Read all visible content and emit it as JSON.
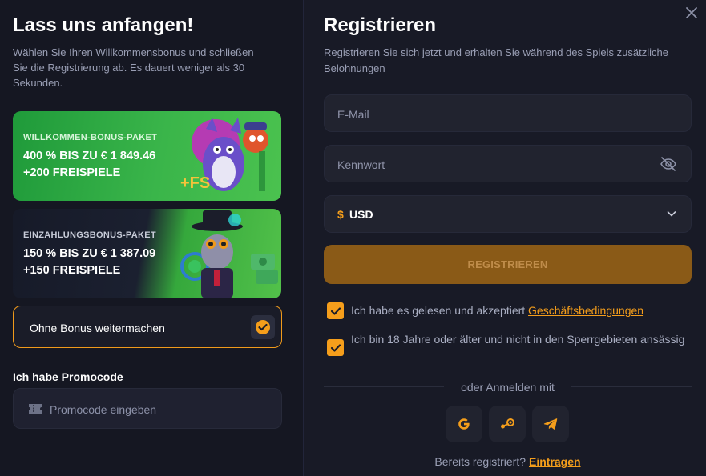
{
  "left": {
    "title": "Lass uns anfangen!",
    "subtitle": "Wählen Sie Ihren Willkommensbonus und schließen Sie die Registrierung ab. Es dauert weniger als 30 Sekunden.",
    "bonuses": [
      {
        "label": "WILLKOMMEN-BONUS-PAKET",
        "line1": "400 % BIS ZU € 1 849.46",
        "line2": "+200 FREISPIELE",
        "badge": "+FS"
      },
      {
        "label": "EINZAHLUNGSBONUS-PAKET",
        "line1": "150 % BIS ZU € 1 387.09",
        "line2": "+150 FREISPIELE"
      }
    ],
    "no_bonus_label": "Ohne Bonus weitermachen",
    "promo_title": "Ich habe Promocode",
    "promo_placeholder": "Promocode eingeben"
  },
  "right": {
    "title": "Registrieren",
    "subtitle": "Registrieren Sie sich jetzt und erhalten Sie während des Spiels zusätzliche Belohnungen",
    "email_placeholder": "E-Mail",
    "password_placeholder": "Kennwort",
    "currency_symbol": "$",
    "currency_value": "USD",
    "register_label": "REGISTRIEREN",
    "terms_text": "Ich habe es gelesen und akzeptiert",
    "terms_link": "Geschäftsbedingungen",
    "age_text": "Ich bin 18 Jahre oder älter und nicht in den Sperrgebieten ansässig",
    "or_text": "oder Anmelden mit",
    "footer_text": "Bereits registriert?",
    "footer_link": "Eintragen"
  },
  "colors": {
    "accent": "#f59e1b",
    "background": "#151722",
    "panel": "#181a26",
    "field": "#21232f",
    "register_button": "#8a5a17"
  },
  "icons": [
    "close-icon",
    "check-icon",
    "ticket-icon",
    "eye-off-icon",
    "chevron-down-icon",
    "google-icon",
    "steam-icon",
    "telegram-icon"
  ]
}
